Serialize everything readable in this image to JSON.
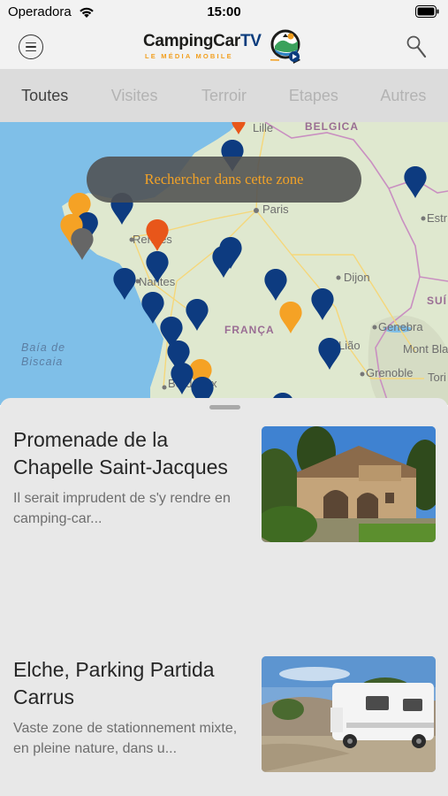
{
  "status_bar": {
    "carrier": "Operadora",
    "time": "15:00",
    "icons": [
      "wifi-icon",
      "battery-icon"
    ]
  },
  "header": {
    "logo_title_main": "CampingCar",
    "logo_title_accent": "TV",
    "logo_subtitle": "LE MÉDIA MOBILE",
    "menu_icon": "hamburger-circle-icon",
    "search_icon": "search-icon"
  },
  "tabs": [
    {
      "label": "Toutes",
      "active": true
    },
    {
      "label": "Visites",
      "active": false
    },
    {
      "label": "Terroir",
      "active": false
    },
    {
      "label": "Etapes",
      "active": false
    },
    {
      "label": "Autres",
      "active": false
    }
  ],
  "map": {
    "search_zone_label": "Rechercher dans cette zone",
    "labels": {
      "lille": "Lille",
      "belgica": "BELGICA",
      "paris": "Paris",
      "rennes": "Rennes",
      "nantes": "Nantes",
      "dijon": "Dijon",
      "franca": "FRANÇA",
      "baia1": "Baía de",
      "baia2": "Biscaia",
      "liao": "Lião",
      "genebra": "Genebra",
      "mont_blanc": "Mont Blanc",
      "grenoble": "Grenoble",
      "torino": "Tori",
      "suic": "SUÍ",
      "estr": "Estr",
      "bordeaux": "Bordeaux"
    },
    "marker_colors": {
      "blue": "#0d3b80",
      "orange": "#f5a225",
      "red": "#e8561a",
      "gray": "#666666"
    },
    "colors": {
      "sea": "#7fbfe8",
      "land": "#dfe8cf",
      "border": "#c98fc1"
    }
  },
  "sheet": {
    "cards": [
      {
        "title": "Promenade de la Chapelle Saint-Jacques",
        "description": "Il serait imprudent de s'y rendre en camping-car...",
        "thumb_icon": "chapel-photo"
      },
      {
        "title": "Elche, Parking Partida Carrus",
        "description": "Vaste zone de stationnement mixte, en pleine nature, dans u...",
        "thumb_icon": "camper-photo"
      }
    ]
  }
}
